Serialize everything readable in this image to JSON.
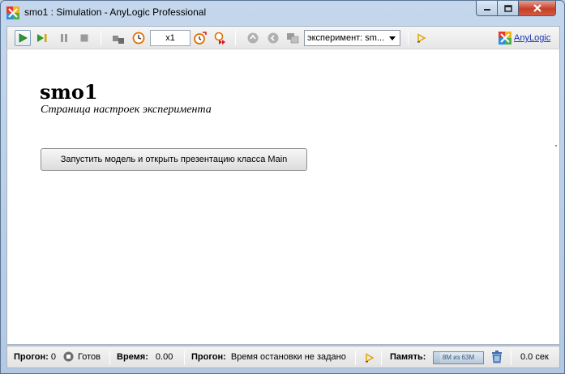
{
  "window": {
    "title": "smo1 : Simulation - AnyLogic Professional"
  },
  "toolbar": {
    "speed": "x1",
    "experiment_selected": "эксперимент: sm...",
    "brand": "AnyLogic"
  },
  "content": {
    "title": "smo1",
    "subtitle": "Страница настроек эксперимента",
    "run_button": "Запустить модель и открыть презентацию класса Main"
  },
  "status": {
    "run_label": "Прогон:",
    "run_value": "0",
    "ready": "Готов",
    "time_label": "Время:",
    "time_value": "0.00",
    "run2_label": "Прогон:",
    "stop_time": "Время остановки не задано",
    "memory_label": "Память:",
    "memory_value": "8M из 63M",
    "memory_fraction": 0.13,
    "elapsed": "0.0 сек"
  },
  "colors": {
    "accent_green": "#2e9a2e",
    "brand_blue": "#1a34b0",
    "close_red": "#c7402a"
  }
}
